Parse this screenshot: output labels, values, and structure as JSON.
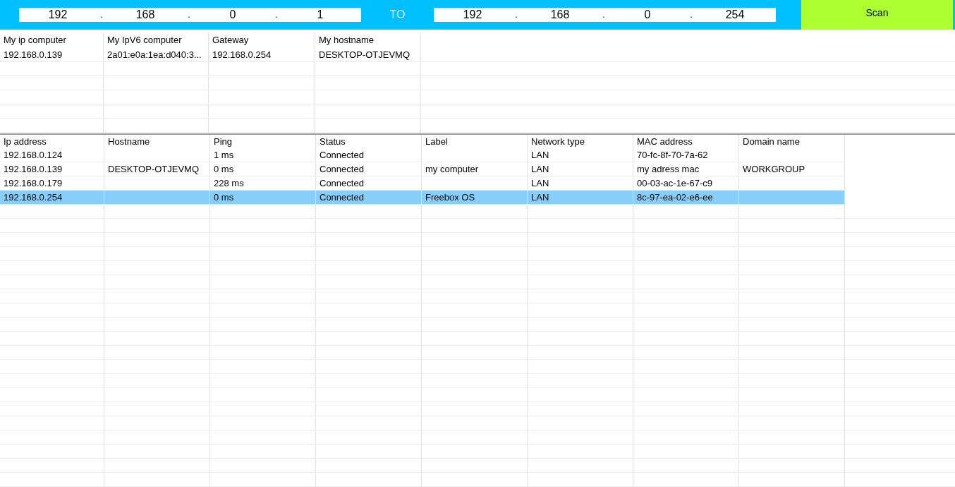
{
  "range": {
    "start": {
      "octets": [
        "192",
        "168",
        "0",
        "1"
      ],
      "separator": "."
    },
    "to_label": "TO",
    "end": {
      "octets": [
        "192",
        "168",
        "0",
        "254"
      ],
      "separator": "."
    },
    "scan_button": "Scan"
  },
  "info_table": {
    "columns": [
      "My ip computer",
      "My IpV6  computer",
      "Gateway",
      "My hostname"
    ],
    "rows": [
      [
        "192.168.0.139",
        "2a01:e0a:1ea:d040:3...",
        "192.168.0.254",
        "DESKTOP-OTJEVMQ"
      ]
    ]
  },
  "hosts_table": {
    "columns": [
      "Ip address",
      "Hostname",
      "Ping",
      "Status",
      "Label",
      "Network type",
      "MAC address",
      "Domain name"
    ],
    "rows": [
      {
        "cells": [
          "192.168.0.124",
          "",
          "1 ms",
          "Connected",
          "",
          "LAN",
          "70-fc-8f-70-7a-62",
          ""
        ],
        "selected": false
      },
      {
        "cells": [
          "192.168.0.139",
          "DESKTOP-OTJEVMQ",
          "0 ms",
          "Connected",
          "my computer",
          "LAN",
          "my adress mac",
          "WORKGROUP"
        ],
        "selected": false
      },
      {
        "cells": [
          "192.168.0.179",
          "",
          "228 ms",
          "Connected",
          "",
          "LAN",
          "00-03-ac-1e-67-c9",
          ""
        ],
        "selected": false
      },
      {
        "cells": [
          "192.168.0.254",
          "",
          "0 ms",
          "Connected",
          "Freebox OS",
          "LAN",
          "8c-97-ea-02-e6-ee",
          ""
        ],
        "selected": true
      }
    ]
  }
}
